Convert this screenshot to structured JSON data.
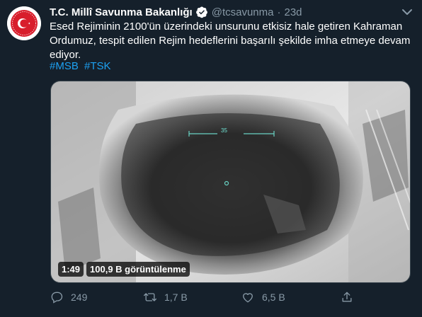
{
  "account": {
    "display_name": "T.C. Millî Savunma Bakanlığı",
    "handle": "@tcsavunma",
    "separator": "·",
    "time": "23d",
    "verified": true
  },
  "tweet": {
    "text": "Esed Rejiminin 2100'ün üzerindeki unsurunu etkisiz hale getiren Kahraman Ordumuz, tespit edilen Rejim hedeflerini başarılı şekilde imha etmeye devam ediyor.",
    "hashtags": [
      "#MSB",
      "#TSK"
    ]
  },
  "media": {
    "type": "video",
    "overlay_number": "35",
    "duration": "1:49",
    "views": "100,9 B görüntülenme"
  },
  "actions": {
    "replies": "249",
    "retweets": "1,7 B",
    "likes": "6,5 B"
  },
  "colors": {
    "background": "#15202b",
    "accent": "#1da1f2",
    "secondary_text": "#8899a6",
    "avatar_red": "#d81e2c"
  },
  "icons": [
    "verified-icon",
    "more-icon",
    "reply-icon",
    "retweet-icon",
    "like-icon",
    "share-icon"
  ]
}
